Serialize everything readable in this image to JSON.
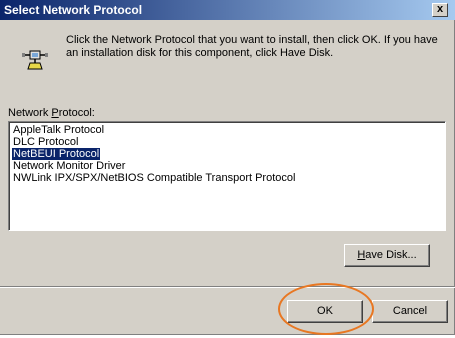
{
  "window": {
    "title": "Select Network Protocol",
    "close_label": "x"
  },
  "instructions": "Click the Network Protocol that you want to install, then click OK.  If you have an installation disk for this component, click Have Disk.",
  "list": {
    "label_prefix": "Network ",
    "label_accel": "P",
    "label_suffix": "rotocol:",
    "items": [
      {
        "label": "AppleTalk Protocol",
        "selected": false
      },
      {
        "label": "DLC Protocol",
        "selected": false
      },
      {
        "label": "NetBEUI Protocol",
        "selected": true
      },
      {
        "label": "Network Monitor Driver",
        "selected": false
      },
      {
        "label": "NWLink IPX/SPX/NetBIOS Compatible Transport Protocol",
        "selected": false
      }
    ]
  },
  "buttons": {
    "have_disk_accel": "H",
    "have_disk_rest": "ave Disk...",
    "ok": "OK",
    "cancel": "Cancel"
  },
  "icons": {
    "network_protocol": "network-protocol-icon"
  },
  "colors": {
    "title_gradient_start": "#0a246a",
    "title_gradient_end": "#a6caf0",
    "selection": "#0a246a",
    "face": "#d4d0c8",
    "highlight_circle": "#e87722"
  }
}
